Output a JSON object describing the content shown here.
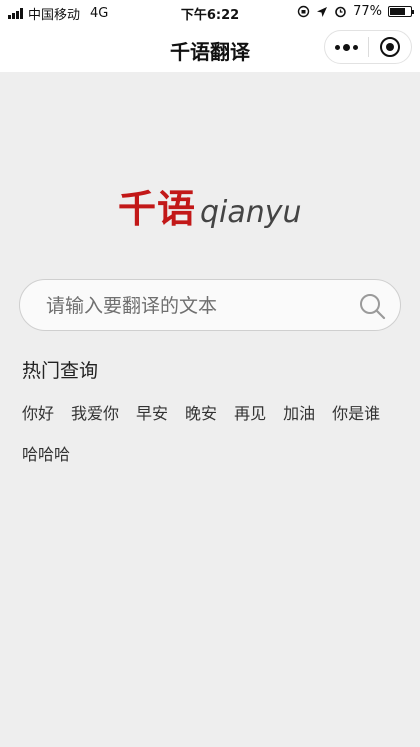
{
  "status_bar": {
    "carrier": "中国移动",
    "network": "4G",
    "time": "下午6:22",
    "battery": "77%",
    "battery_level": 0.77
  },
  "nav": {
    "title": "千语翻译"
  },
  "logo": {
    "cn": "千语",
    "en": "qianyu",
    "color": "#c21818"
  },
  "search": {
    "placeholder": "请输入要翻译的文本",
    "value": ""
  },
  "hot": {
    "title": "热门查询",
    "tags": [
      "你好",
      "我爱你",
      "早安",
      "晚安",
      "再见",
      "加油",
      "你是谁",
      "哈哈哈"
    ]
  }
}
